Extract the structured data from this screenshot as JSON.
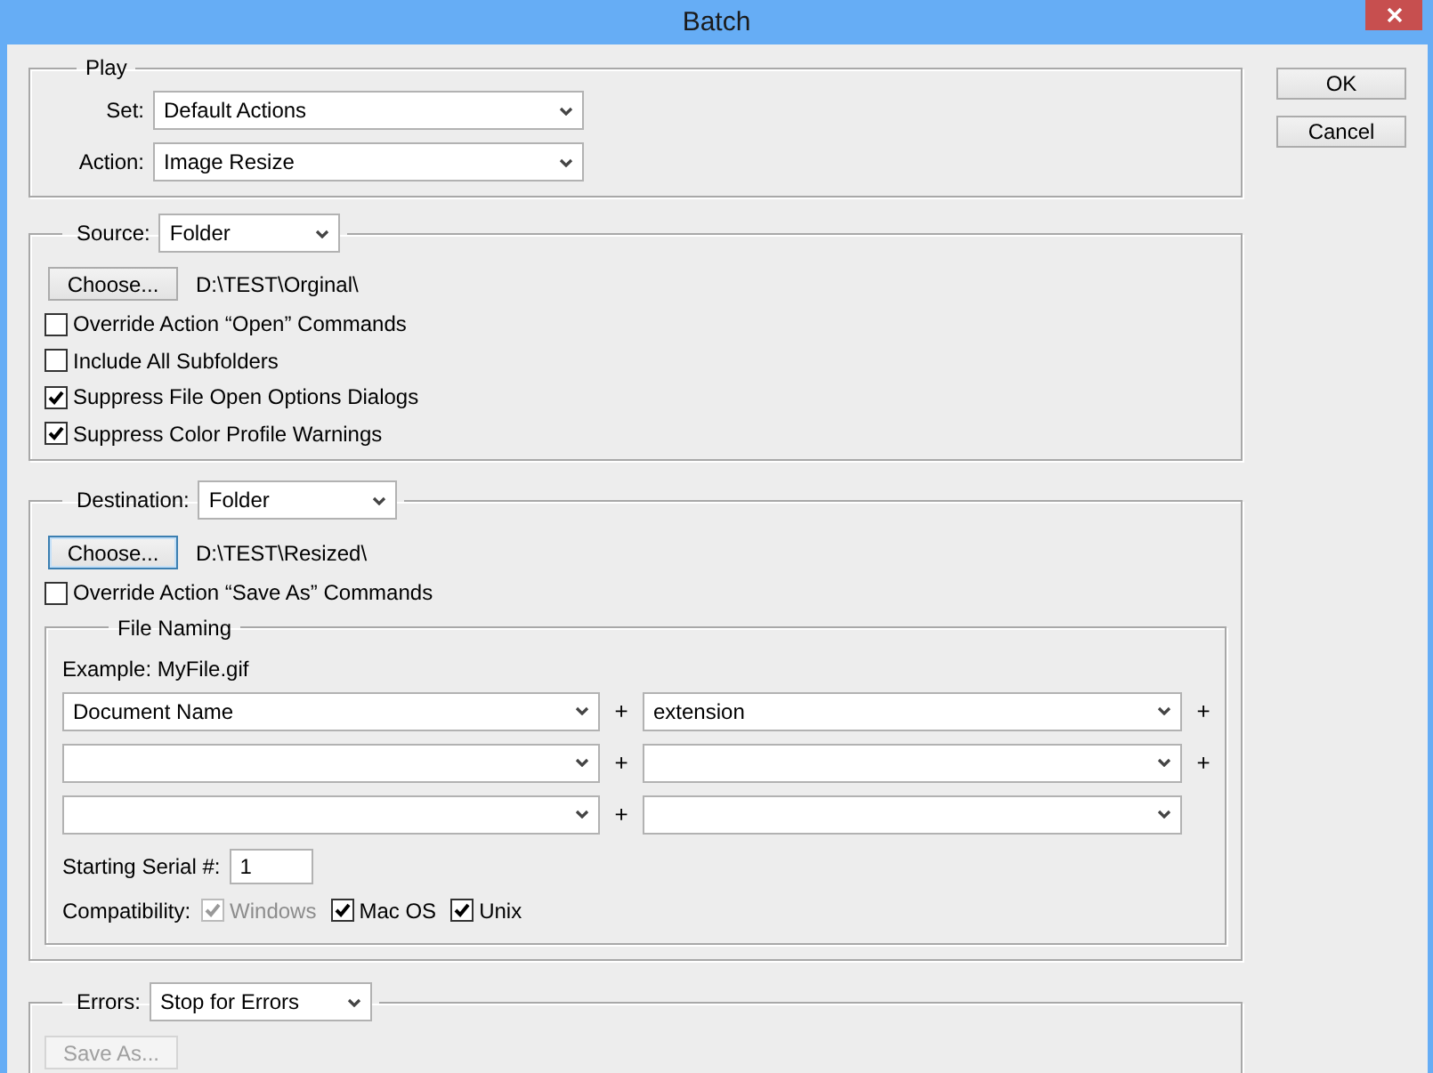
{
  "window": {
    "title": "Batch"
  },
  "play": {
    "title": "Play",
    "fields": [
      {
        "label": "Set:",
        "value": "Default Actions"
      },
      {
        "label": "Action:",
        "value": "Image Resize"
      }
    ]
  },
  "source": {
    "label": "Source:",
    "value": "Folder",
    "choose_button": {
      "label": "Choose...",
      "focused": false
    },
    "path": "D:\\TEST\\Orginal\\",
    "options": [
      {
        "label": "Override Action “Open” Commands",
        "checked": false,
        "disabled": false
      },
      {
        "label": "Include All Subfolders",
        "checked": false,
        "disabled": false
      },
      {
        "label": "Suppress File Open Options Dialogs",
        "checked": true,
        "disabled": false
      },
      {
        "label": "Suppress Color Profile Warnings",
        "checked": true,
        "disabled": false
      }
    ]
  },
  "destination": {
    "label": "Destination:",
    "value": "Folder",
    "choose_button": {
      "label": "Choose...",
      "focused": true
    },
    "path": "D:\\TEST\\Resized\\",
    "options": [
      {
        "label": "Override Action “Save As” Commands",
        "checked": false,
        "disabled": false
      }
    ],
    "file_naming": {
      "title": "File Naming",
      "example": "Example: MyFile.gif",
      "rows": [
        {
          "left": "Document Name",
          "plus": "+",
          "right": "extension",
          "trailing_plus": "+"
        },
        {
          "plus": "+",
          "trailing_plus": "+"
        },
        {
          "plus": "+"
        }
      ],
      "serial": {
        "label": "Starting Serial #:",
        "value": "1"
      },
      "compatibility": {
        "label": "Compatibility:",
        "options": [
          {
            "label": "Windows",
            "checked": true,
            "disabled": true
          },
          {
            "label": "Mac OS",
            "checked": true,
            "disabled": false
          },
          {
            "label": "Unix",
            "checked": true,
            "disabled": false
          }
        ]
      }
    }
  },
  "errors": {
    "label": "Errors:",
    "value": "Stop for Errors",
    "save_as_button": {
      "label": "Save As...",
      "disabled": true
    }
  },
  "buttons": [
    {
      "label": "OK"
    },
    {
      "label": "Cancel"
    }
  ]
}
